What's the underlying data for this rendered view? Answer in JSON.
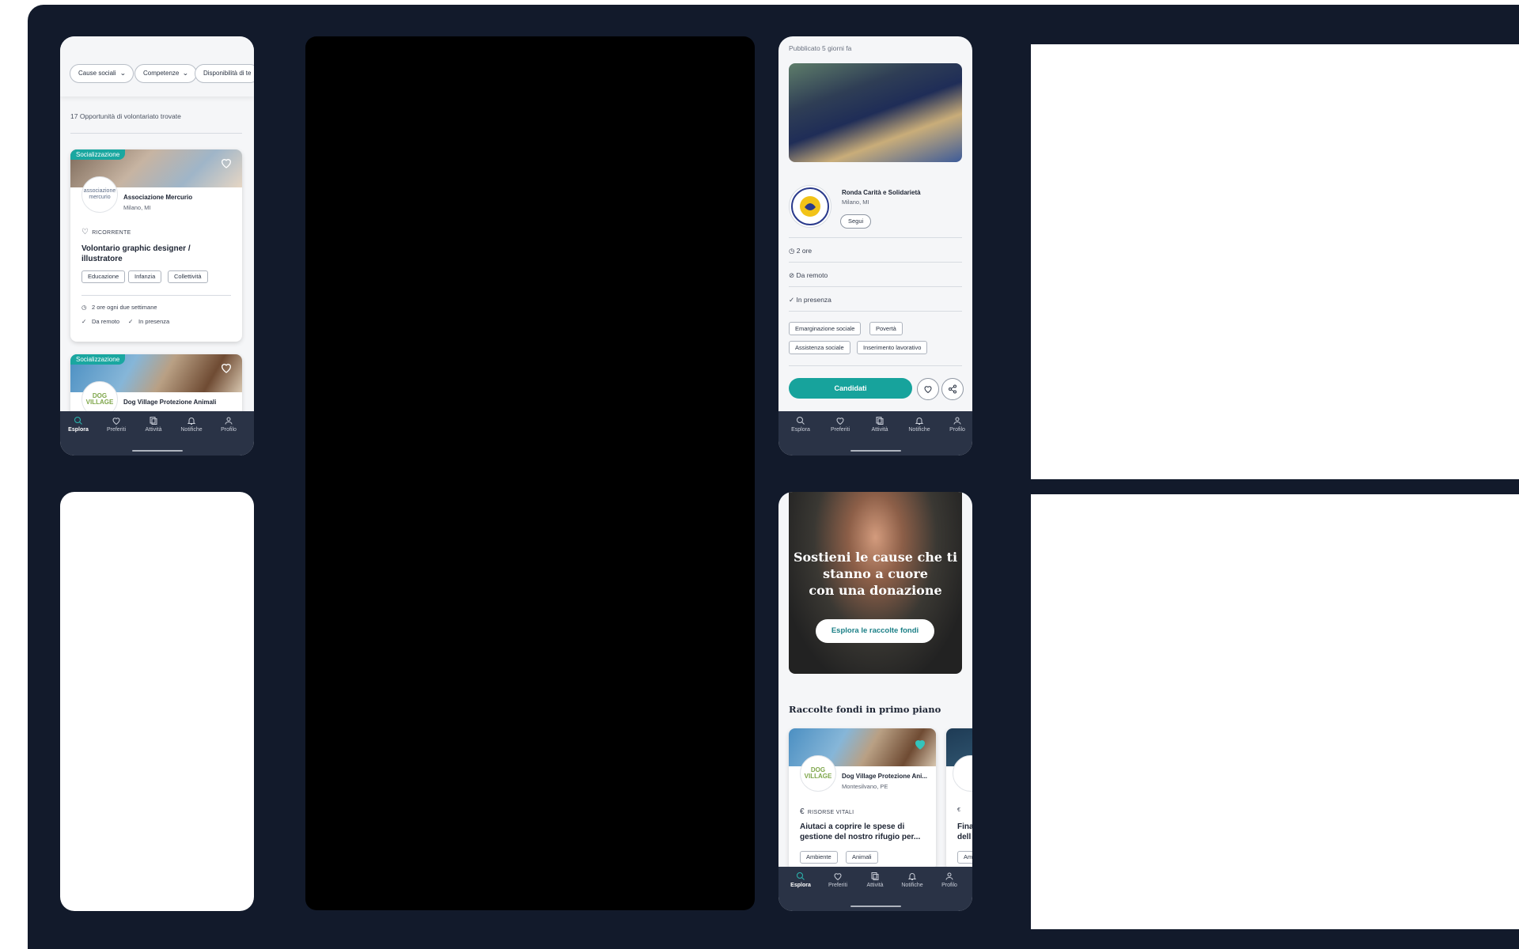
{
  "list_screen": {
    "filters": [
      "Cause sociali",
      "Competenze",
      "Disponibilità di te"
    ],
    "result_count": "17 Opportunità di volontariato trovate",
    "cards": [
      {
        "badge": "Socializzazione",
        "org": "Associazione Mercurio",
        "logo_text": "associazione mercurio",
        "city": "Milano, MI",
        "type": "RICORRENTE",
        "title": "Volontario graphic designer / illustratore",
        "tags": [
          "Educazione",
          "Infanzia",
          "Collettività"
        ],
        "frequency": "2 ore ogni due settimane",
        "modes": [
          "Da remoto",
          "In presenza"
        ]
      },
      {
        "badge": "Socializzazione",
        "org": "Dog Village Protezione Animali",
        "logo_text": "DOG VILLAGE"
      }
    ]
  },
  "nav": {
    "items": [
      "Esplora",
      "Preferiti",
      "Attività",
      "Notifiche",
      "Profilo"
    ],
    "active": "Esplora"
  },
  "detail_screen": {
    "published": "Pubblicato 5 giorni fa",
    "org": "Ronda Carità e Solidarietà",
    "city": "Milano, MI",
    "follow": "Segui",
    "duration": "2 ore",
    "remote": "Da remoto",
    "in_person": "In presenza",
    "tags": [
      "Emarginazione sociale",
      "Povertà",
      "Assistenza sociale",
      "Inserimento lavorativo"
    ],
    "apply": "Candidati"
  },
  "donation_screen": {
    "hero_title_1": "Sostieni le cause che ti",
    "hero_title_2": "stanno a cuore",
    "hero_title_3": "con una donazione",
    "hero_button": "Esplora le raccolte fondi",
    "section_title": "Raccolte fondi in primo piano",
    "card": {
      "org": "Dog Village Protezione Ani...",
      "city": "Montesilvano, PE",
      "type": "RISORSE VITALI",
      "title_1": "Aiutaci a coprire le spese di",
      "title_2": "gestione del nostro rifugio per...",
      "tags": [
        "Ambiente",
        "Animali"
      ]
    },
    "peek_card": {
      "title_1": "Fina",
      "title_2": "dell",
      "tag": "Am"
    }
  },
  "colors": {
    "background": "#121a2b",
    "accent": "#17a39c",
    "nav": "#2a3346"
  }
}
